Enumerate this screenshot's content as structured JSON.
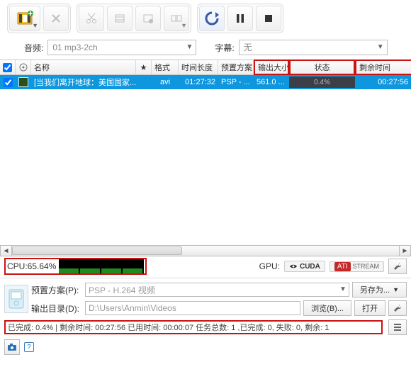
{
  "toolbar": {
    "add_btn_color": "#2c9c2c"
  },
  "second_row": {
    "audio_label": "音频:",
    "audio_value": "01 mp3-2ch",
    "subtitle_label": "字幕:",
    "subtitle_value": "无"
  },
  "columns": {
    "check": " ",
    "type": " ",
    "name": "名称",
    "star": "★",
    "format": "格式",
    "duration": "时间长度",
    "preset": "预置方案",
    "outsize": "输出大小",
    "status": "状态",
    "remaining": "剩余时间"
  },
  "row": {
    "name": "[当我们离开地球：美国国家...",
    "format": "avi",
    "duration": "01:27:32",
    "preset": "PSP - ...",
    "outsize": "561.0 ...",
    "progress": "0.4%",
    "remaining": "00:27:56"
  },
  "cpu": {
    "label": "CPU:65.64%"
  },
  "gpu": {
    "label": "GPU:",
    "cuda": "CUDA",
    "ati": "ATI",
    "stream": "STREAM"
  },
  "opts": {
    "preset_label": "预置方案(P):",
    "preset_value": "PSP - H.264 视频",
    "outdir_label": "输出目录(D):",
    "outdir_value": "D:\\Users\\Anmin\\Videos",
    "saveas_btn": "另存为...",
    "browse_btn": "浏览(B)...",
    "open_btn": "打开"
  },
  "status": {
    "text": "已完成: 0.4% | 剩余时间: 00:27:56 已用时间: 00:00:07 任务总数: 1 ,已完成: 0, 失败: 0, 剩余: 1"
  }
}
